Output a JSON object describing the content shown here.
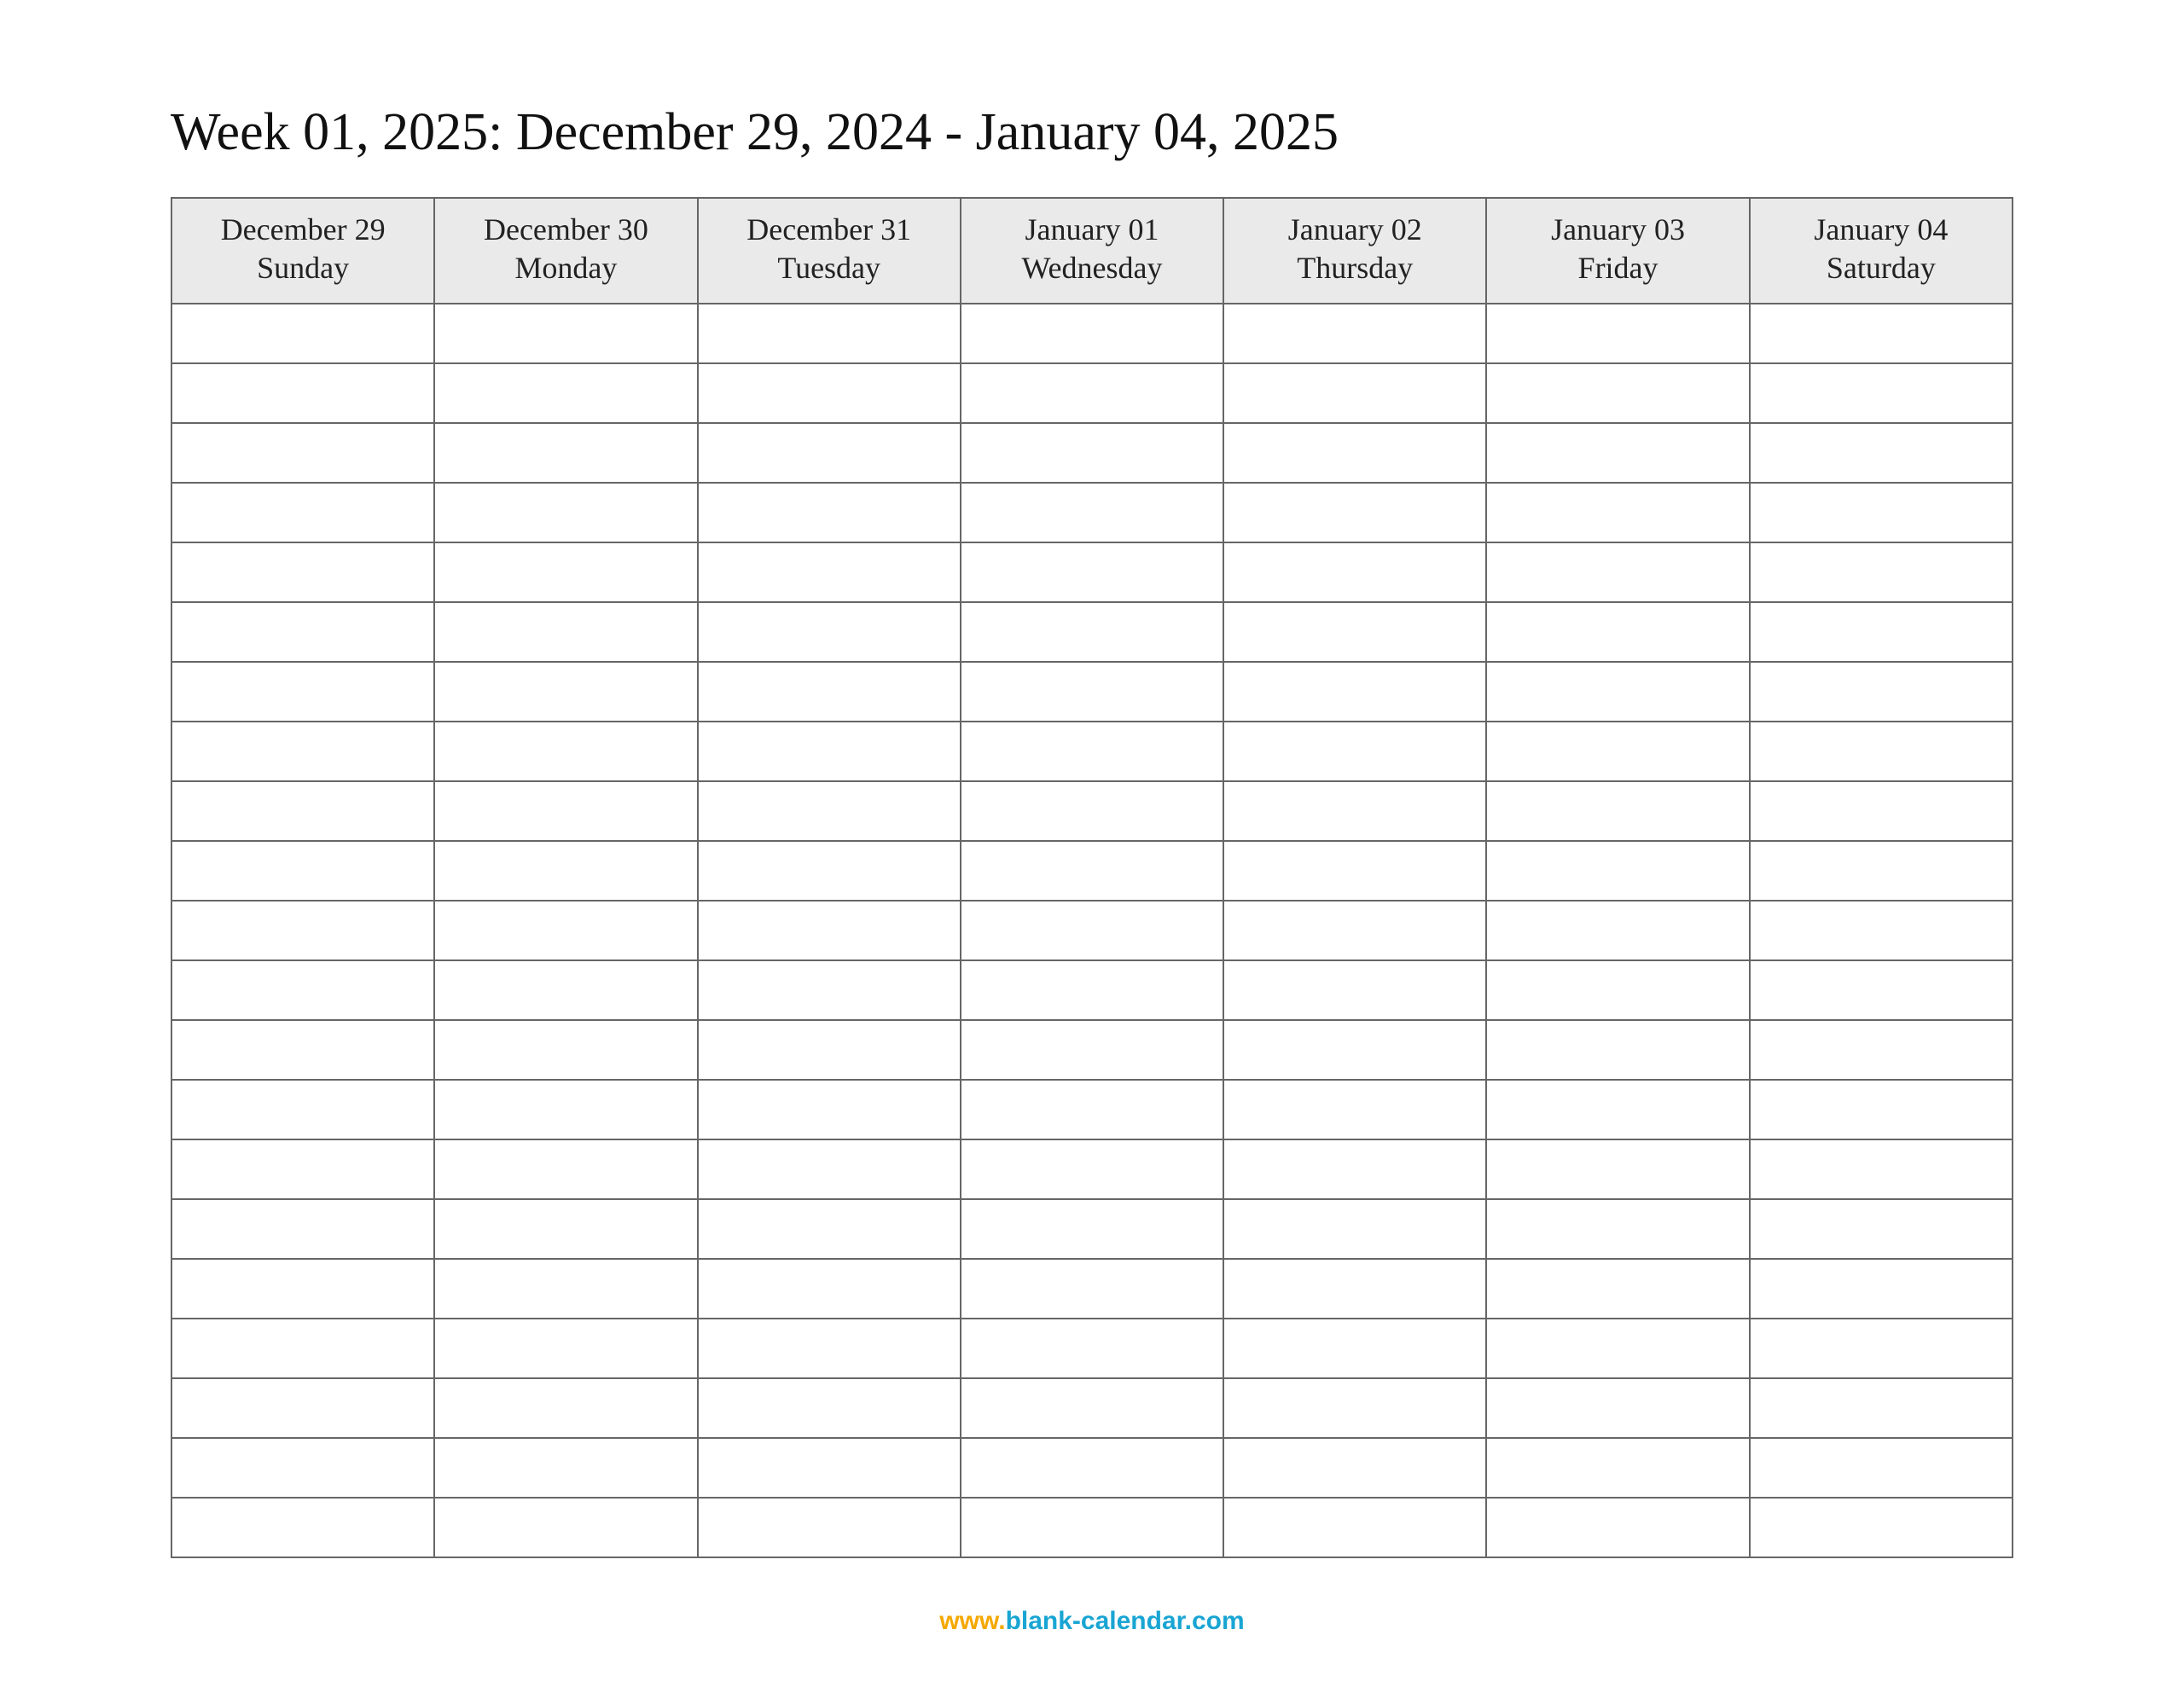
{
  "title": "Week 01, 2025: December 29, 2024 - January 04, 2025",
  "columns": [
    {
      "date": "December 29",
      "dow": "Sunday"
    },
    {
      "date": "December 30",
      "dow": "Monday"
    },
    {
      "date": "December 31",
      "dow": "Tuesday"
    },
    {
      "date": "January 01",
      "dow": "Wednesday"
    },
    {
      "date": "January 02",
      "dow": "Thursday"
    },
    {
      "date": "January 03",
      "dow": "Friday"
    },
    {
      "date": "January 04",
      "dow": "Saturday"
    }
  ],
  "row_count": 21,
  "footer": {
    "www": "www.",
    "domain": "blank-calendar.com"
  }
}
